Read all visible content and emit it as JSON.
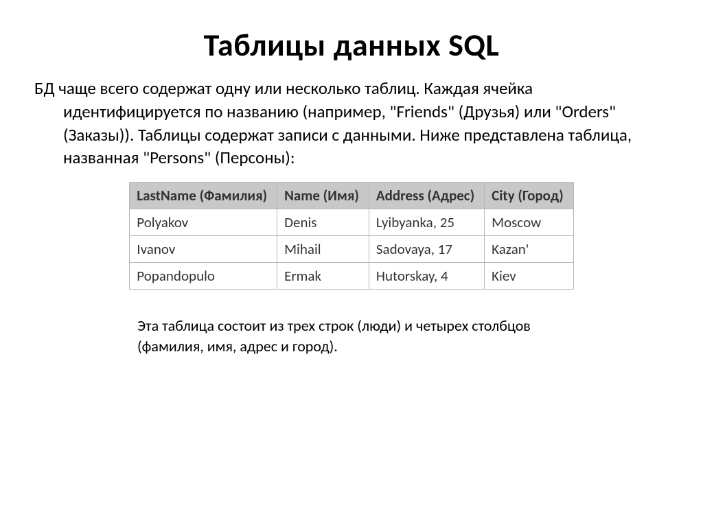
{
  "title": "Таблицы данных SQL",
  "body": "БД чаще всего содержат одну или несколько таблиц. Каждая ячейка идентифицируется по названию (например, \"Friends\" (Друзья) или \"Orders\" (Заказы)). Таблицы содержат записи с данными. Ниже представлена таблица, названная \"Persons\" (Персоны):",
  "table": {
    "headers": [
      "LastName (Фамилия)",
      "Name (Имя)",
      "Address (Адрес)",
      "City (Город)"
    ],
    "rows": [
      [
        "Polyakov",
        "Denis",
        "Lyibyanka, 25",
        "Moscow"
      ],
      [
        "Ivanov",
        "Mihail",
        "Sadovaya, 17",
        "Kazan'"
      ],
      [
        "Popandopulo",
        "Ermak",
        "Hutorskay, 4",
        "Kiev"
      ]
    ]
  },
  "caption": "Эта таблица состоит из трех строк (люди) и четырех столбцов (фамилия, имя, адрес и город)."
}
